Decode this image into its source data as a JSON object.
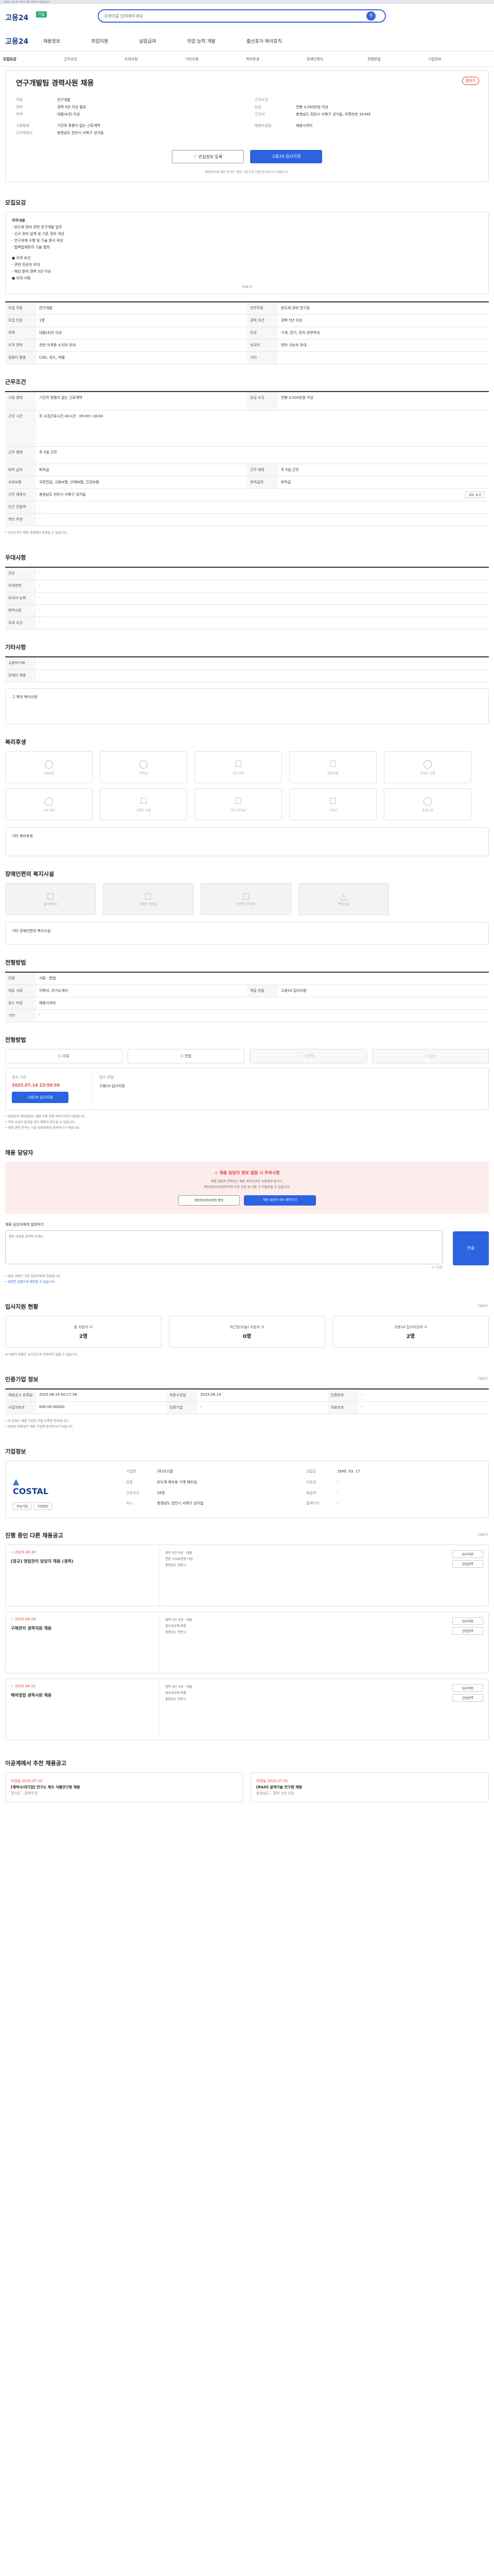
{
  "top_banner": "고용24 · 워크넷이 새로운 통합 서비스로 바뀌었습니다",
  "header": {
    "logo": "고용24",
    "tag": "기업",
    "search_placeholder": "검색어를 입력해주세요"
  },
  "gnb": {
    "brand": "고용24",
    "items": [
      "채용정보",
      "취업지원",
      "실업급여",
      "직업 능력 개발",
      "출산휴가·육아휴직"
    ]
  },
  "subnav": [
    "모집요강",
    "근무조건",
    "우대사항",
    "기타사항",
    "복리후생",
    "장애인복지",
    "전형방법",
    "기업정보"
  ],
  "job": {
    "title": "연구개발팀 경력사원 채용",
    "bookmark": "찜하기",
    "left": [
      {
        "k": "직종",
        "v": "연구개발"
      },
      {
        "k": "경력",
        "v": "경력 5년 이상 필요"
      },
      {
        "k": "학력",
        "v": "대졸(4년) 이상"
      },
      {
        "k": "고용형태",
        "v": "기간의 정함이 없는 근로계약"
      },
      {
        "k": "근무예정지",
        "v": "충청남도 천안시 서북구 성거읍"
      }
    ],
    "right": [
      {
        "k": "근무조건",
        "v": ""
      },
      {
        "k": "임금",
        "v": "연봉 3,500만원 이상"
      },
      {
        "k": "근무지",
        "v": "충청남도 천안시 서북구 성거읍, 우편번호 31049"
      },
      {
        "k": "채용마감일",
        "v": "채용시까지"
      }
    ],
    "btn_interest": "관심정보 등록",
    "btn_apply": "고용24 입사지원",
    "notice": "채용정보에 대한 문의는 해당 기업으로 직접 문의하시기 바랍니다."
  },
  "recruit": {
    "title": "모집요강",
    "right": "직무 안내",
    "duty_label": "직무내용",
    "duty_lines": [
      "- 반도체 장비 관련 연구개발 업무",
      "- 신규 장비 설계 및 기존 장비 개선",
      "- 연구과제 수행 및 기술 문서 작성",
      "- 협력업체와의 기술 협의"
    ],
    "req_lines": [
      "● 자격 요건",
      "- 관련 전공자 우대",
      "- 해당 분야 경력 5년 이상",
      "● 우대 사항"
    ],
    "more": "더보기",
    "rows": [
      [
        {
          "k": "모집 직종",
          "v": "연구개발"
        },
        {
          "k": "관련직종",
          "v": "반도체 장비 연구원"
        }
      ],
      [
        {
          "k": "모집 인원",
          "v": "1명"
        },
        {
          "k": "경력 조건",
          "v": "경력 5년 이상"
        }
      ],
      [
        {
          "k": "학력",
          "v": "대졸(4년) 이상"
        },
        {
          "k": "전공",
          "v": "기계, 전기, 전자 관련학과"
        }
      ],
      [
        {
          "k": "자격 면허",
          "v": "관련 자격증 소지자 우대"
        },
        {
          "k": "외국어",
          "v": "영어 가능자 우대"
        }
      ],
      [
        {
          "k": "컴퓨터 활용",
          "v": "CAD, 워드, 엑셀"
        },
        {
          "k": "기타",
          "v": ""
        }
      ]
    ]
  },
  "work": {
    "title": "근무조건",
    "rows": [
      [
        {
          "k": "고용 형태",
          "v": "기간의 정함이 없는 근로계약"
        },
        {
          "k": "임금 조건",
          "v": "연봉 3,500만원 이상"
        }
      ],
      [
        {
          "k": "근무 시간",
          "v": "주 소정근로시간 40시간 · 09:00~18:00"
        },
        {
          "k": "",
          "v": ""
        }
      ],
      [
        {
          "k": "근무 형태",
          "v": "주 5일 근무"
        },
        {
          "k": "",
          "v": ""
        }
      ],
      [
        {
          "k": "퇴직 급여",
          "v": "퇴직금"
        },
        {
          "k": "근무 예정",
          "v": "주 5일 근무"
        }
      ],
      [
        {
          "k": "사회보험",
          "v": "국민연금, 고용보험, 산재보험, 건강보험"
        },
        {
          "k": "퇴직급여",
          "v": "퇴직금"
        }
      ],
      [
        {
          "k": "근무 예정지",
          "v": "충청남도 천안시 서북구 성거읍"
        },
        {
          "k": "",
          "v": ""
        }
      ],
      [
        {
          "k": "인근 전철역",
          "v": "-"
        },
        {
          "k": "",
          "v": ""
        }
      ],
      [
        {
          "k": "복리 후생",
          "v": "-"
        },
        {
          "k": "",
          "v": ""
        }
      ]
    ],
    "map_btn": "지도 보기",
    "note": "* 근로조건은 채용 과정에서 변경될 수 있습니다."
  },
  "pref": {
    "title": "우대사항",
    "rows": [
      {
        "k": "전공",
        "v": "-"
      },
      {
        "k": "자격면허",
        "v": "-"
      },
      {
        "k": "외국어 능력",
        "v": "-"
      },
      {
        "k": "병역사항",
        "v": "-"
      },
      {
        "k": "우대 조건",
        "v": "-"
      }
    ]
  },
  "etc": {
    "title": "기타사항",
    "rows": [
      {
        "k": "고용허가제",
        "v": "-"
      },
      {
        "k": "장애인 채용",
        "v": "-"
      }
    ],
    "note": "그 밖의 복리사항"
  },
  "welfare": {
    "title": "복리후생",
    "row1": [
      "4대보험",
      "퇴직금",
      "경조사비",
      "명절선물",
      "생일자 선물"
    ],
    "row2": [
      "식사 제공",
      "교통비 지원",
      "자녀 학자금",
      "기숙사",
      "휴양시설"
    ],
    "note": "기타 복리후생"
  },
  "disability": {
    "title": "장애인편의 복지시설",
    "items": [
      "엘리베이터",
      "장애인 화장실",
      "장애인 주차장",
      "편의시설"
    ],
    "note": "기타 장애인편의 복지시설"
  },
  "process": {
    "title": "전형방법",
    "rows": [
      [
        {
          "k": "전형",
          "v": "서류 · 면접"
        },
        {
          "k": "",
          "v": ""
        }
      ],
      [
        {
          "k": "제출 서류",
          "v": "이력서, 자기소개서"
        },
        {
          "k": "제출 방법",
          "v": "고용24 입사지원"
        }
      ],
      [
        {
          "k": "접수 마감",
          "v": "채용시까지"
        },
        {
          "k": "",
          "v": ""
        }
      ],
      [
        {
          "k": "기타",
          "v": "-"
        },
        {
          "k": "",
          "v": ""
        }
      ]
    ]
  },
  "apply": {
    "title": "전형방법",
    "steps": [
      "서류",
      "면접",
      "합격",
      "입사"
    ],
    "period_label": "접수 기간",
    "period_date": "2025.07.14 23:59:59",
    "apply_btn": "고용24 입사지원",
    "method_label": "접수 방법",
    "method_value": "고용24 입사지원",
    "notes": [
      "• 지원자의 개인정보는 채용 전형 진행 목적으로만 사용됩니다.",
      "• 허위 사실이 발견될 경우 채용이 취소될 수 있습니다.",
      "• 채용 관련 문의는 기업 담당자에게 문의하시기 바랍니다."
    ]
  },
  "contact": {
    "title": "채용 담당자",
    "pink_title": "채용 담당자 정보 열람 시 주의사항",
    "pink_sub1": "채용 담당자 연락처는 채용 목적으로만 사용해야 합니다.",
    "pink_sub2": "개인정보보호법에 따라 무단 수집 및 이용 시 처벌받을 수 있습니다.",
    "btn1": "개인정보처리방침 확인",
    "btn2": "채용 담당자 정보 확인하기",
    "q_label": "채용 담당자에게 질문하기",
    "q_placeholder": "질문 내용을 입력해 주세요.",
    "q_count": "0 / 500",
    "send": "전송",
    "notes": [
      "• 질문 내용은 기업 담당자에게 전달됩니다.",
      "• 답변은 알림으로 확인할 수 있습니다."
    ]
  },
  "stats": {
    "title": "입사지원 현황",
    "right": "더보기",
    "items": [
      {
        "label": "총 지원자 수",
        "value": "2명"
      },
      {
        "label": "최근일(오늘) 지원자 수",
        "value": "0명"
      },
      {
        "label": "고용24 입사지원자 수",
        "value": "2명"
      }
    ],
    "note": "※ 지원자 현황은 실시간으로 반영되지 않을 수 있습니다."
  },
  "info": {
    "title": "인증기업 정보",
    "right": "더보기",
    "rows": [
      [
        {
          "k": "채용공고 등록일",
          "v": "2025.06.14 00:17:56"
        },
        {
          "k": "최종수정일",
          "v": "2025.06.14"
        },
        {
          "k": "인증번호",
          "v": "-"
        }
      ],
      [
        {
          "k": "사업자번호",
          "v": "000-00-00000"
        },
        {
          "k": "인증기업",
          "v": "-"
        },
        {
          "k": "대표번호",
          "v": "-"
        }
      ]
    ],
    "notes": [
      "• 위 정보는 채용 기업이 직접 등록한 정보입니다.",
      "• 정보의 정확성은 해당 기업에 문의하시기 바랍니다."
    ]
  },
  "company": {
    "title": "기업정보",
    "logo": "COSTAL",
    "btn1": "관심기업",
    "btn2": "기업정보",
    "info": [
      {
        "k": "기업명",
        "v": "(주)코스탈"
      },
      {
        "k": "설립일",
        "v": "1999. 03. 17"
      },
      {
        "k": "업종",
        "v": "반도체 제조용 기계 제조업"
      },
      {
        "k": "자본금",
        "v": "-"
      },
      {
        "k": "근로자수",
        "v": "35명"
      },
      {
        "k": "매출액",
        "v": "-"
      },
      {
        "k": "주소",
        "v": "충청남도 천안시 서북구 성거읍"
      },
      {
        "k": "홈페이지",
        "v": "-"
      }
    ]
  },
  "other_jobs": {
    "title": "진행 중인 다른 채용공고",
    "right": "더보기",
    "items": [
      {
        "date": "~ 2025.06.30",
        "name": "[정규] 영업관리 담당자 채용 (경력)",
        "lines": [
          "경력 3년 이상 · 대졸",
          "연봉 3,000만원 이상",
          "충청남도 천안시"
        ],
        "btns": [
          "입사지원",
          "관심등록"
        ]
      },
      {
        "date": "~ 2025.06.28",
        "name": "구매관리 경력직원 채용",
        "lines": [
          "경력 2년 이상 · 대졸",
          "회사내규에 따름",
          "충청남도 천안시"
        ],
        "btns": [
          "입사지원",
          "관심등록"
        ]
      },
      {
        "date": "~ 2025.06.22",
        "name": "해외영업 경력사원 채용",
        "lines": [
          "경력 3년 이상 · 대졸",
          "회사내규에 따름",
          "충청남도 천안시"
        ],
        "btns": [
          "입사지원",
          "관심등록"
        ]
      }
    ]
  },
  "recommend": {
    "title": "이공계에서 추천 채용공고",
    "items": [
      {
        "tag": "마감일 2025.07.10",
        "name": "[제약사/대기업] 연구소 제조 식품연구원 채용",
        "sub": "경기도 · 경력무관"
      },
      {
        "tag": "마감일 2025.07.01",
        "name": "[R&D] 설계기술 연구원 채용",
        "sub": "충청남도 · 경력 3년 이상"
      }
    ]
  }
}
